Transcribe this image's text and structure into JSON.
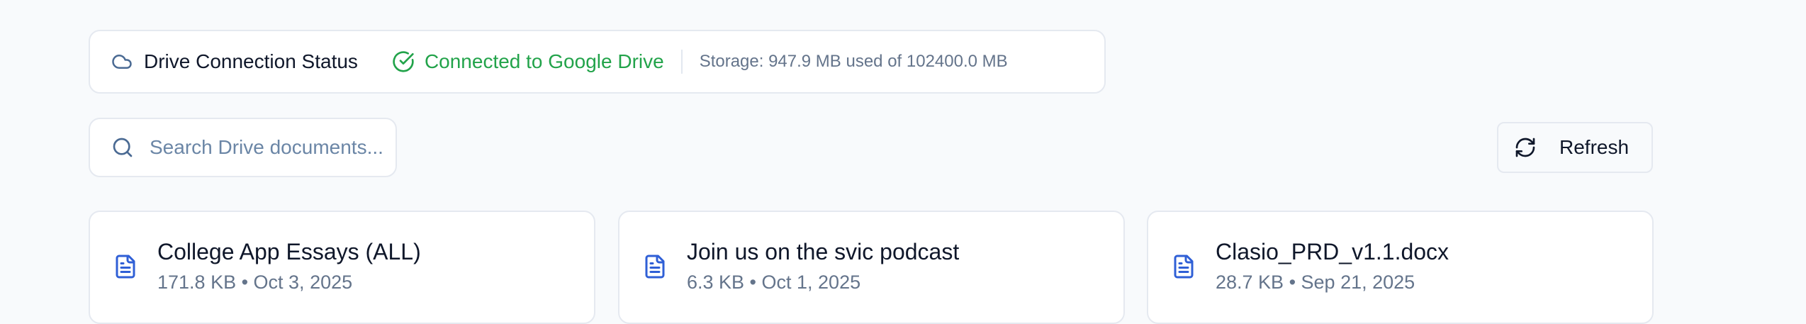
{
  "status": {
    "title": "Drive Connection Status",
    "connection": "Connected to Google Drive",
    "storage": "Storage: 947.9 MB used of 102400.0 MB",
    "icons": [
      "cloud-icon",
      "check-circle-icon"
    ],
    "colors": {
      "connected": "#22a34a",
      "muted": "#64748b"
    }
  },
  "search": {
    "placeholder": "Search Drive documents...",
    "icon": "search-icon"
  },
  "toolbar": {
    "refresh_label": "Refresh",
    "refresh_icon": "refresh-icon"
  },
  "documents": [
    {
      "title": "College App Essays (ALL)",
      "meta": "171.8 KB • Oct 3, 2025",
      "icon": "document-icon"
    },
    {
      "title": "Join us on the svic podcast",
      "meta": "6.3 KB • Oct 1, 2025",
      "icon": "document-icon"
    },
    {
      "title": "Clasio_PRD_v1.1.docx",
      "meta": "28.7 KB • Sep 21, 2025",
      "icon": "document-icon"
    }
  ]
}
